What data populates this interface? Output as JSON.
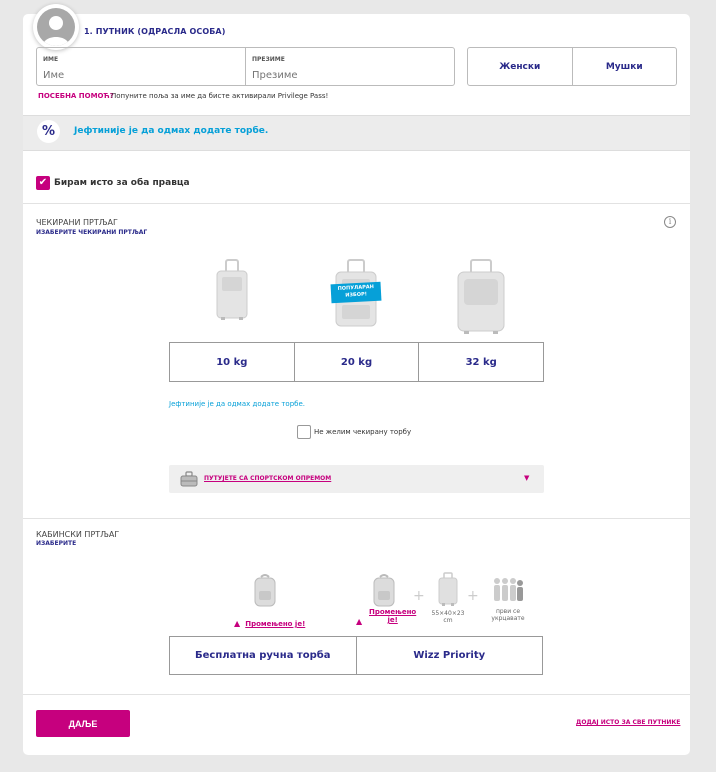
{
  "passenger": {
    "title": "1. ПУТНИК (ОДРАСЛА ОСОБА)",
    "first_name_label": "ИМЕ",
    "first_name_placeholder": "Име",
    "last_name_label": "ПРЕЗИМЕ",
    "last_name_placeholder": "Презиме",
    "gender_female": "Женски",
    "gender_male": "Мушки",
    "special_help": "ПОСЕБНА ПОМОЋ?",
    "privilege_text": "Попуните поља за име да бисте активирали Privilege Pass!"
  },
  "promo": {
    "icon": "%",
    "text": "Јефтиније је да одмах додате торбе."
  },
  "same_both_ways": {
    "checked": true,
    "label": "Бирам исто за оба правца"
  },
  "checked_baggage": {
    "title": "ЧЕКИРАНИ ПРТЉАГ",
    "subtitle": "ИЗАБЕРИТЕ ЧЕКИРАНИ ПРТЉАГ",
    "popular_badge_line1": "ПОПУЛАРАН",
    "popular_badge_line2": "ИЗБОР!",
    "weights": [
      "10 kg",
      "20 kg",
      "32 kg"
    ],
    "cheaper_text": "Јефтиније је да одмах додате торбе.",
    "no_bag_label": "Не желим чекирану торбу",
    "sport_equipment": "ПУТУЈЕТЕ СА СПОРТСКОМ ОПРЕМОМ"
  },
  "cabin_baggage": {
    "title": "КАБИНСКИ ПРТЉАГ",
    "subtitle": "ИЗАБЕРИТЕ",
    "changed_1": "Промењено је!",
    "changed_2_line1": "Промењено",
    "changed_2_line2": "је!",
    "dimensions_line1": "55×40×23",
    "dimensions_line2": "cm",
    "board_first_line1": "први се",
    "board_first_line2": "укрцавате",
    "options": [
      "Бесплатна ручна торба",
      "Wizz Priority"
    ]
  },
  "footer": {
    "next_button": "ДАЉЕ",
    "add_same_all": "ДОДАЈ ИСТО ЗА СВЕ ПУТНИКЕ"
  },
  "colors": {
    "brand_magenta": "#c6007e",
    "brand_navy": "#2a2a8a",
    "promo_blue": "#06a0d8"
  }
}
